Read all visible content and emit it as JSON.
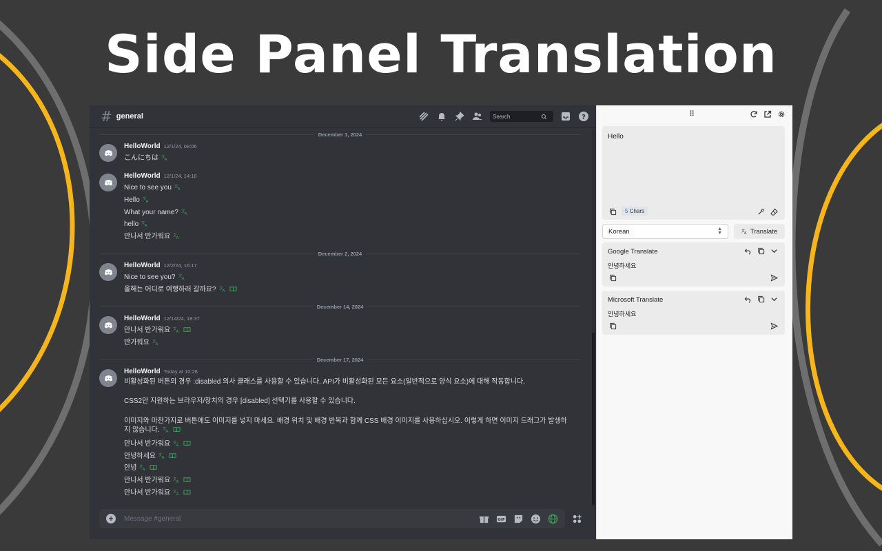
{
  "hero": {
    "title": "Side Panel Translation"
  },
  "colors": {
    "accent_ring": "#f5b51b",
    "gray_ring": "#6e6e6e",
    "background": "#3a3a3b",
    "discord_bg": "#313338",
    "translate_icon": "#3ba55c",
    "book_icon": "#3ba55c"
  },
  "discord": {
    "channel": "general",
    "search_placeholder": "Search",
    "header_icons": [
      "threads-icon",
      "bell-icon",
      "pin-icon",
      "members-icon",
      "inbox-icon",
      "help-icon"
    ],
    "composer_placeholder": "Message #general",
    "composer_icons": [
      "gift-icon",
      "gif-icon",
      "sticker-icon",
      "emoji-icon",
      "globe-icon"
    ],
    "dividers": [
      "December 1, 2024",
      "December 2, 2024",
      "December 14, 2024",
      "December 17, 2024"
    ],
    "messages": [
      {
        "author": "HelloWorld",
        "time": "12/1/24, 08:06",
        "lines": [
          "こんにちは"
        ]
      },
      {
        "author": "HelloWorld",
        "time": "12/1/24, 14:18",
        "lines": [
          "Nice to see you",
          "Hello",
          "What your name?",
          "hello",
          "만나서 반가워요"
        ]
      },
      {
        "author": "HelloWorld",
        "time": "12/2/24, 16:17",
        "lines": [
          "Nice to see you?",
          "올해는 어디로 여행하러 갈까요?"
        ]
      },
      {
        "author": "HelloWorld",
        "time": "12/14/24, 18:37",
        "lines": [
          "만나서 반가워요",
          "반가워요"
        ]
      },
      {
        "author": "HelloWorld",
        "time": "Today at 10:28",
        "lines": [
          "비활성화된 버튼의 경우 :disabled 의사 클래스를 사용할 수 있습니다. API가 비활성화된 모든 요소(일반적으로 양식 요소)에 대해 작동합니다.",
          "CSS2만 지원하는 브라우저/장치의 경우 [disabled] 선택기를 사용할 수 있습니다.",
          "이미지와 마찬가지로 버튼에도 이미지를 넣지 마세요. 배경 위치 및 배경 반복과 함께 CSS 배경 이미지를 사용하십시오. 이렇게 하면 이미지 드래그가 발생하지 않습니다.",
          "만나서 반가워요",
          "안녕하세요",
          "안녕",
          "만나서 반가워요",
          "만나서 반가워요"
        ]
      }
    ]
  },
  "panel": {
    "input_text": "Hello",
    "char_count": "5",
    "char_label": "Chars",
    "target_language": "Korean",
    "translate_label": "Translate",
    "results": [
      {
        "engine": "Google Translate",
        "text": "안녕하세요"
      },
      {
        "engine": "Microsoft Translate",
        "text": "안녕하세요"
      }
    ]
  }
}
